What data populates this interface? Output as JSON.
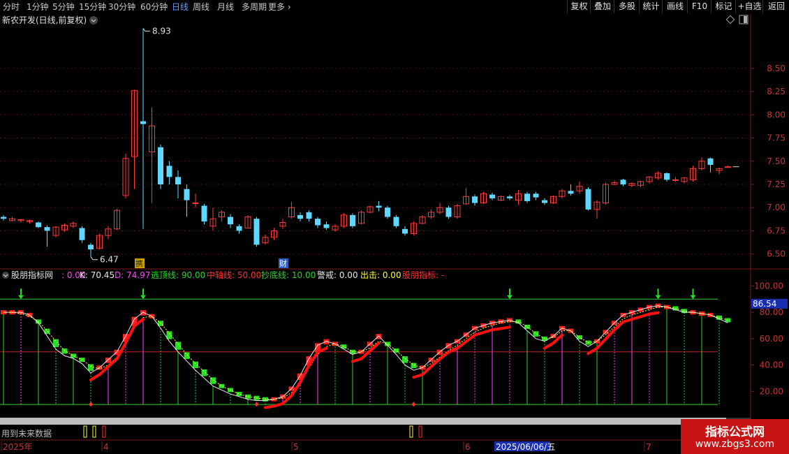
{
  "toolbar": {
    "periods": [
      "分时",
      "1分钟",
      "5分钟",
      "15分钟",
      "30分钟",
      "60分钟",
      "日线",
      "周线",
      "月线",
      "多周期",
      "更多"
    ],
    "active": "日线",
    "right_buttons": [
      "复权",
      "叠加",
      "多股",
      "统计",
      "画线",
      "F10",
      "标记",
      "+自选",
      "返回"
    ]
  },
  "main": {
    "title": "新农开发(日线,前复权)",
    "high_label": "8.93",
    "low_label": "6.47",
    "badge_1": "携",
    "badge_2": "财",
    "y_ticks": [
      "8.50",
      "8.25",
      "8.00",
      "7.75",
      "7.50",
      "7.25",
      "7.00",
      "6.75",
      "6.50"
    ]
  },
  "indicator": {
    "name": "股朋指标网",
    "items": [
      {
        "text": ": 0.00",
        "color": "#ff40ff"
      },
      {
        "text": "K: 70.45",
        "color": "#e8e8e8"
      },
      {
        "text": "D: 74.97",
        "color": "#ff40ff"
      },
      {
        "text": "逃顶线: 90.00",
        "color": "#2bd32b"
      },
      {
        "text": "中轴线: 50.00",
        "color": "#ff3030"
      },
      {
        "text": "抄底线: 10.00",
        "color": "#2bd32b"
      },
      {
        "text": "警戒: 0.00",
        "color": "#e8e8e8"
      },
      {
        "text": "出击: 0.00",
        "color": "#ffff40"
      },
      {
        "text": "股朋指标: -",
        "color": "#ff3030"
      }
    ],
    "y_ticks": [
      "100.00",
      "80.00",
      "60.00",
      "40.00",
      "20.00"
    ],
    "current_value": "86.54"
  },
  "bottom": {
    "future_label": "用到未来数据",
    "months": [
      "2025年",
      "4",
      "5",
      "6",
      "7"
    ],
    "date_label": "2025/06/06/五"
  },
  "watermark": {
    "title": "指标公式网",
    "url": "www.zbgs3.com"
  },
  "colors": {
    "up": "#ff3a3a",
    "down": "#5fd8ff",
    "grid": "#5a1010",
    "accent": "#5aa0ff"
  },
  "chart_data": {
    "type": "candlestick",
    "candles": [
      [
        6.9,
        6.88,
        6.86,
        6.92
      ],
      [
        6.86,
        6.88,
        6.85,
        6.9
      ],
      [
        6.86,
        6.87,
        6.84,
        6.88
      ],
      [
        6.85,
        6.86,
        6.83,
        6.87
      ],
      [
        6.84,
        6.79,
        6.78,
        6.85
      ],
      [
        6.79,
        6.75,
        6.58,
        6.81
      ],
      [
        6.7,
        6.79,
        6.68,
        6.8
      ],
      [
        6.76,
        6.81,
        6.74,
        6.83
      ],
      [
        6.8,
        6.83,
        6.78,
        6.85
      ],
      [
        6.78,
        6.65,
        6.62,
        6.8
      ],
      [
        6.6,
        6.55,
        6.47,
        6.62
      ],
      [
        6.56,
        6.7,
        6.55,
        6.72
      ],
      [
        6.7,
        6.77,
        6.66,
        6.8
      ],
      [
        6.77,
        6.97,
        6.76,
        6.99
      ],
      [
        7.13,
        7.53,
        7.1,
        7.58
      ],
      [
        7.55,
        8.26,
        7.2,
        8.27
      ],
      [
        7.93,
        7.9,
        6.77,
        8.93
      ],
      [
        7.6,
        7.88,
        7.05,
        8.08
      ],
      [
        7.65,
        7.25,
        7.2,
        7.68
      ],
      [
        7.45,
        7.33,
        7.25,
        7.5
      ],
      [
        7.33,
        7.25,
        7.1,
        7.4
      ],
      [
        7.2,
        7.08,
        6.9,
        7.25
      ],
      [
        7.05,
        7.05,
        7.0,
        7.15
      ],
      [
        7.02,
        6.85,
        6.82,
        7.04
      ],
      [
        6.8,
        6.88,
        6.75,
        7.0
      ],
      [
        6.9,
        6.95,
        6.85,
        6.97
      ],
      [
        6.9,
        6.82,
        6.78,
        6.93
      ],
      [
        6.8,
        6.75,
        6.72,
        6.82
      ],
      [
        6.78,
        6.9,
        6.78,
        6.92
      ],
      [
        6.88,
        6.6,
        6.58,
        6.9
      ],
      [
        6.62,
        6.68,
        6.6,
        6.71
      ],
      [
        6.68,
        6.75,
        6.65,
        6.78
      ],
      [
        6.8,
        6.84,
        6.77,
        6.88
      ],
      [
        6.9,
        7.0,
        6.88,
        7.06
      ],
      [
        6.92,
        6.88,
        6.85,
        6.95
      ],
      [
        6.95,
        6.88,
        6.85,
        6.97
      ],
      [
        6.88,
        6.81,
        6.78,
        6.9
      ],
      [
        6.82,
        6.78,
        6.76,
        6.85
      ],
      [
        6.76,
        6.8,
        6.74,
        6.82
      ],
      [
        6.8,
        6.92,
        6.78,
        6.94
      ],
      [
        6.92,
        6.8,
        6.78,
        6.94
      ],
      [
        6.83,
        6.95,
        6.82,
        6.97
      ],
      [
        6.95,
        7.01,
        6.94,
        7.02
      ],
      [
        7.02,
        7.0,
        6.96,
        7.07
      ],
      [
        7.0,
        6.9,
        6.88,
        7.02
      ],
      [
        6.9,
        6.8,
        6.78,
        6.92
      ],
      [
        6.77,
        6.72,
        6.7,
        6.8
      ],
      [
        6.72,
        6.83,
        6.7,
        6.85
      ],
      [
        6.83,
        6.9,
        6.82,
        6.92
      ],
      [
        6.9,
        6.95,
        6.88,
        6.98
      ],
      [
        6.95,
        7.0,
        6.93,
        7.05
      ],
      [
        7.0,
        6.9,
        6.88,
        7.02
      ],
      [
        6.9,
        7.02,
        6.88,
        7.04
      ],
      [
        7.04,
        7.12,
        7.03,
        7.21
      ],
      [
        7.12,
        7.05,
        7.02,
        7.14
      ],
      [
        7.05,
        7.15,
        7.04,
        7.17
      ],
      [
        7.14,
        7.1,
        7.08,
        7.16
      ],
      [
        7.08,
        7.12,
        7.07,
        7.13
      ],
      [
        7.12,
        7.1,
        7.08,
        7.14
      ],
      [
        7.08,
        7.15,
        7.03,
        7.19
      ],
      [
        7.15,
        7.07,
        7.05,
        7.17
      ],
      [
        7.15,
        7.11,
        7.08,
        7.17
      ],
      [
        7.08,
        7.05,
        7.03,
        7.1
      ],
      [
        7.05,
        7.12,
        7.04,
        7.13
      ],
      [
        7.12,
        7.18,
        7.1,
        7.2
      ],
      [
        7.18,
        7.15,
        7.13,
        7.25
      ],
      [
        7.18,
        7.23,
        7.15,
        7.28
      ],
      [
        7.2,
        6.98,
        6.97,
        7.22
      ],
      [
        6.98,
        7.06,
        6.88,
        7.08
      ],
      [
        7.05,
        7.25,
        7.03,
        7.27
      ],
      [
        7.25,
        7.27,
        7.24,
        7.29
      ],
      [
        7.3,
        7.25,
        7.23,
        7.31
      ],
      [
        7.24,
        7.26,
        7.22,
        7.27
      ],
      [
        7.24,
        7.28,
        7.22,
        7.29
      ],
      [
        7.28,
        7.33,
        7.26,
        7.34
      ],
      [
        7.32,
        7.37,
        7.3,
        7.39
      ],
      [
        7.37,
        7.3,
        7.28,
        7.38
      ],
      [
        7.3,
        7.3,
        7.28,
        7.33
      ],
      [
        7.28,
        7.32,
        7.26,
        7.33
      ],
      [
        7.3,
        7.42,
        7.28,
        7.45
      ],
      [
        7.42,
        7.5,
        7.4,
        7.54
      ],
      [
        7.53,
        7.46,
        7.38,
        7.54
      ],
      [
        7.4,
        7.42,
        7.36,
        7.43
      ],
      [
        7.44,
        7.44,
        7.43,
        7.45
      ]
    ],
    "k_line": [
      80,
      80,
      80,
      78,
      72,
      62,
      52,
      47,
      45,
      41,
      34,
      38,
      44,
      50,
      62,
      75,
      80,
      77,
      68,
      58,
      50,
      43,
      36,
      30,
      24,
      21,
      18,
      16,
      14,
      13,
      13,
      14,
      16,
      22,
      32,
      45,
      55,
      58,
      56,
      52,
      48,
      50,
      56,
      62,
      55,
      48,
      40,
      36,
      38,
      44,
      50,
      55,
      58,
      63,
      68,
      70,
      72,
      73,
      74,
      72,
      66,
      60,
      58,
      62,
      68,
      66,
      58,
      54,
      58,
      65,
      72,
      78,
      80,
      82,
      84,
      85,
      84,
      82,
      80,
      80,
      79,
      78,
      75,
      72
    ],
    "d_line": [
      80,
      80,
      79,
      77,
      73,
      66,
      58,
      51,
      47,
      44,
      39,
      37,
      40,
      46,
      56,
      68,
      76,
      77,
      72,
      64,
      56,
      48,
      41,
      35,
      29,
      24,
      21,
      18,
      16,
      15,
      14,
      14,
      15,
      19,
      27,
      38,
      48,
      54,
      56,
      54,
      50,
      50,
      53,
      58,
      56,
      51,
      45,
      40,
      38,
      41,
      46,
      51,
      55,
      60,
      65,
      68,
      70,
      72,
      73,
      73,
      69,
      64,
      60,
      61,
      66,
      66,
      61,
      57,
      58,
      63,
      69,
      75,
      78,
      80,
      82,
      84,
      84,
      83,
      81,
      80,
      79,
      78,
      76,
      74
    ],
    "escape_line": 90,
    "middle_line": 50,
    "bottom_line": 10,
    "price_ylim": [
      6.4,
      8.95
    ],
    "indicator_ylim": [
      0,
      105
    ]
  }
}
